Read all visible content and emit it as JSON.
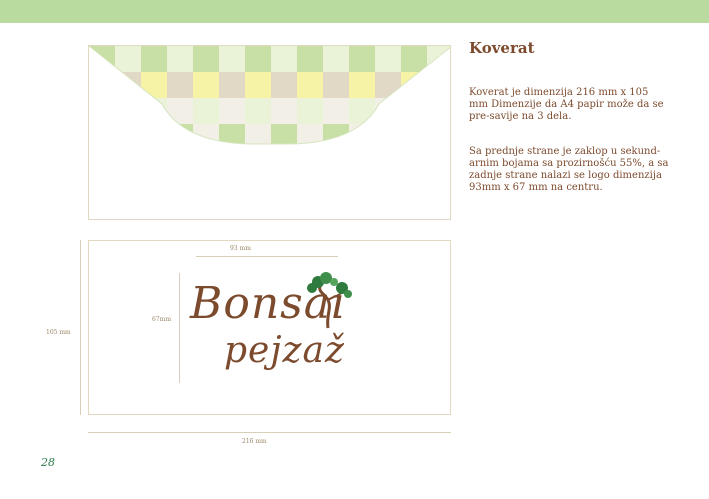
{
  "page": {
    "title": "Koverat",
    "paragraph1": "Koverat je dimenzija 216 mm x 105 mm Dimenzije da A4 papir može da se pre-savije na 3 dela.",
    "paragraph2": "Sa prednje strane je zaklop u sekund-arnim bojama sa prozirnošću 55%, a sa zadnje strane nalazi se logo dimenzija 93mm x 67 mm na centru.",
    "page_number": "28"
  },
  "dimensions": {
    "logo_width": "93 mm",
    "logo_height": "67mm",
    "envelope_height": "105 mm",
    "envelope_width": "216 mm"
  },
  "logo": {
    "line1": "Bonsai",
    "line2": "pejzaž"
  },
  "colors": {
    "topbar": "#b9dba0",
    "text_brown": "#7c4a2d",
    "page_number_green": "#2d7a4a",
    "flap_pattern": [
      "#c8e0a6",
      "#f6f2a6",
      "#e2d8c6",
      "#eaf2d8",
      "#f2efe6"
    ]
  }
}
